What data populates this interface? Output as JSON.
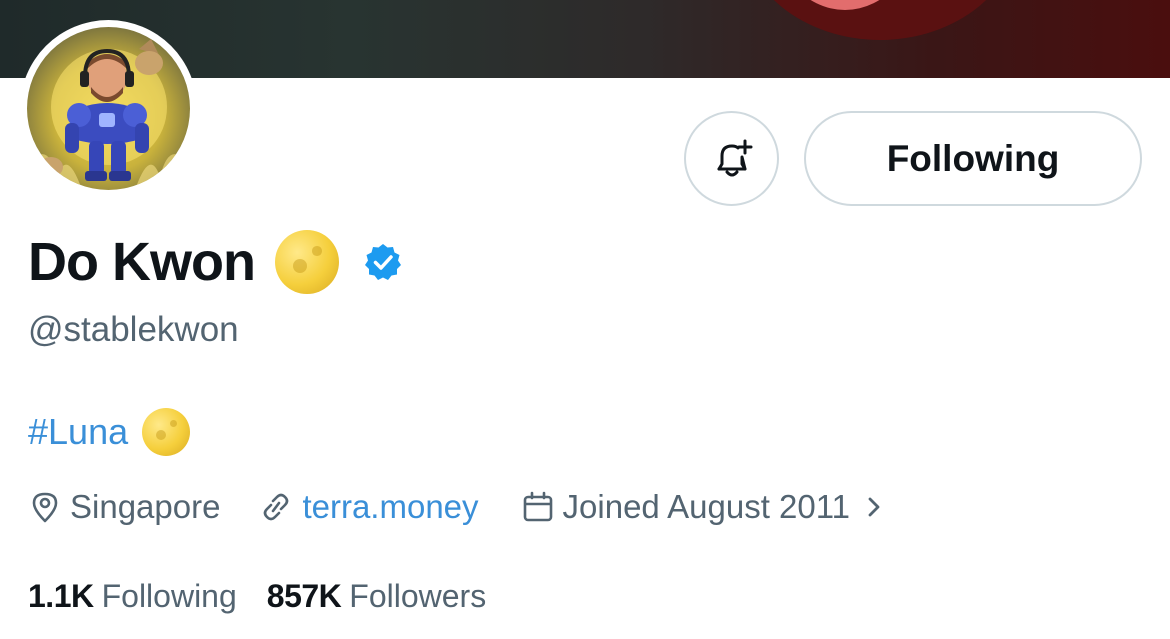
{
  "profile": {
    "display_name": "Do Kwon",
    "handle": "@stablekwon",
    "bio_hashtag": "#Luna",
    "location": "Singapore",
    "website": "terra.money",
    "joined": "Joined August 2011"
  },
  "actions": {
    "follow_label": "Following",
    "notify_icon": "bell-plus-icon"
  },
  "stats": {
    "following_count": "1.1K",
    "following_label": "Following",
    "followers_count": "857K",
    "followers_label": "Followers"
  },
  "colors": {
    "link": "#3a8fd8",
    "verified": "#1d9bf0",
    "secondary_text": "#536471"
  }
}
